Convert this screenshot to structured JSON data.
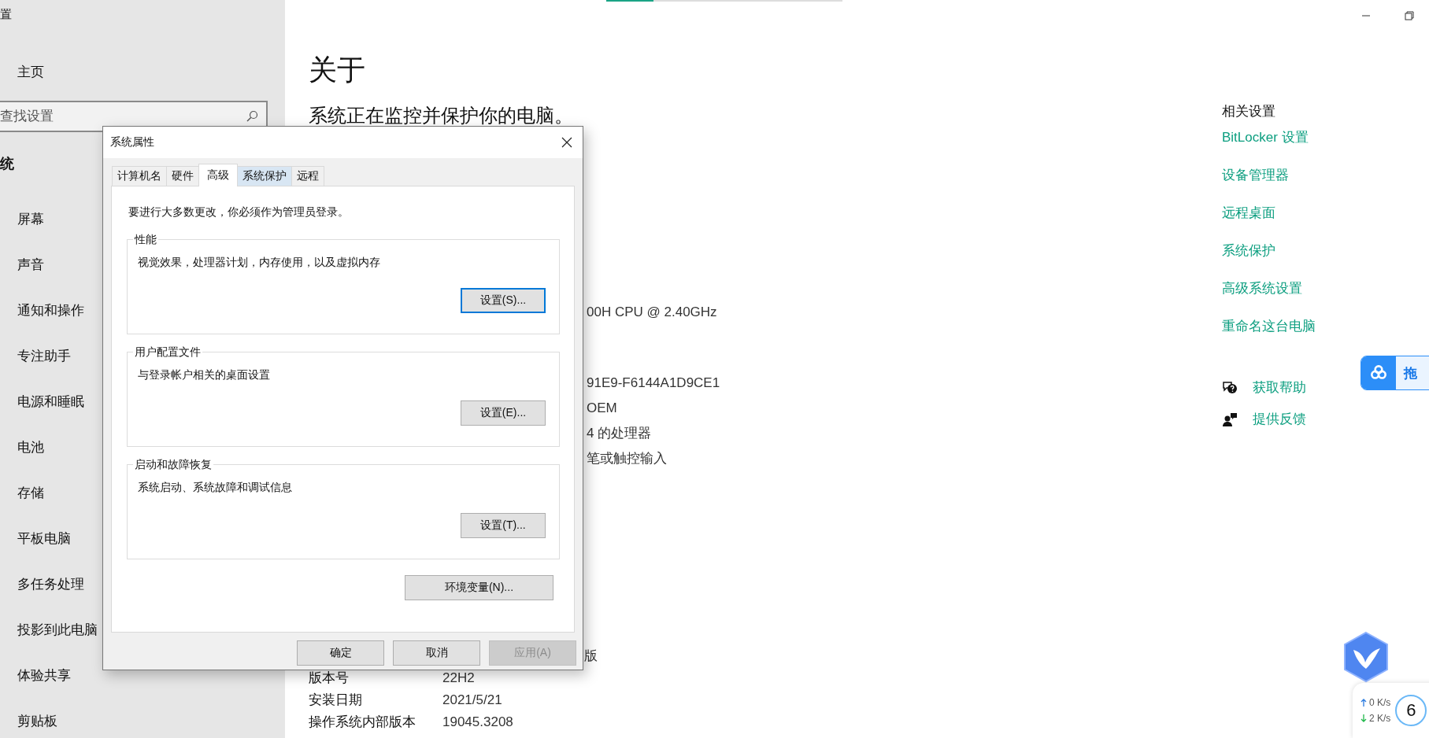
{
  "sidebar": {
    "title": "置",
    "home": "主页",
    "search": {
      "placeholder": "查找设置"
    },
    "section": "统",
    "items": [
      {
        "label": "屏幕"
      },
      {
        "label": "声音"
      },
      {
        "label": "通知和操作"
      },
      {
        "label": "专注助手"
      },
      {
        "label": "电源和睡眠"
      },
      {
        "label": "电池"
      },
      {
        "label": "存储"
      },
      {
        "label": "平板电脑"
      },
      {
        "label": "多任务处理"
      },
      {
        "label": "投影到此电脑"
      },
      {
        "label": "体验共享"
      },
      {
        "label": "剪贴板"
      }
    ]
  },
  "loading_bar": {
    "level": 0.2
  },
  "window_controls": [
    {
      "kind": "minimize"
    },
    {
      "kind": "restore"
    }
  ],
  "page": {
    "title": "关于",
    "subtitle": "系统正在监控并保护你的电脑。",
    "partial_values": [
      "00H CPU @ 2.40GHz",
      "91E9-F6144A1D9CE1",
      "OEM",
      "4 的处理器",
      "笔或触控输入"
    ],
    "edition_fragment": "版",
    "info_rows": [
      {
        "label": "版本号",
        "value": "22H2"
      },
      {
        "label": "安装日期",
        "value": "2021/5/21"
      },
      {
        "label": "操作系统内部版本",
        "value": "19045.3208"
      }
    ]
  },
  "related": {
    "heading": "相关设置",
    "links": [
      "BitLocker 设置",
      "设备管理器",
      "远程桌面",
      "系统保护",
      "高级系统设置",
      "重命名这台电脑"
    ]
  },
  "help_links": [
    {
      "kind": "help",
      "label": "获取帮助"
    },
    {
      "kind": "feedback",
      "label": "提供反馈"
    }
  ],
  "dialog": {
    "title": "系统属性",
    "tabs": [
      {
        "label": "计算机名",
        "selected": false,
        "hovered": false
      },
      {
        "label": "硬件",
        "selected": false,
        "hovered": false
      },
      {
        "label": "高级",
        "selected": true,
        "hovered": false
      },
      {
        "label": "系统保护",
        "selected": false,
        "hovered": true
      },
      {
        "label": "远程",
        "selected": false,
        "hovered": false
      }
    ],
    "notice": "要进行大多数更改，你必须作为管理员登录。",
    "groups": [
      {
        "legend": "性能",
        "description": "视觉效果，处理器计划，内存使用，以及虚拟内存",
        "button": {
          "label": "设置(S)...",
          "focused": true
        }
      },
      {
        "legend": "用户配置文件",
        "description": "与登录帐户相关的桌面设置",
        "button": {
          "label": "设置(E)...",
          "focused": false
        }
      },
      {
        "legend": "启动和故障恢复",
        "description": "系统启动、系统故障和调试信息",
        "button": {
          "label": "设置(T)...",
          "focused": false
        }
      }
    ],
    "env_button": "环境变量(N)...",
    "buttons": [
      {
        "label": "确定",
        "disabled": false
      },
      {
        "label": "取消",
        "disabled": false
      },
      {
        "label": "应用(A)",
        "disabled": true
      }
    ]
  },
  "overlays": {
    "drag_widget": {
      "label": "拖"
    },
    "speed_widget": {
      "upload": "0 K/s",
      "download": "2 K/s",
      "badge": "6"
    }
  }
}
